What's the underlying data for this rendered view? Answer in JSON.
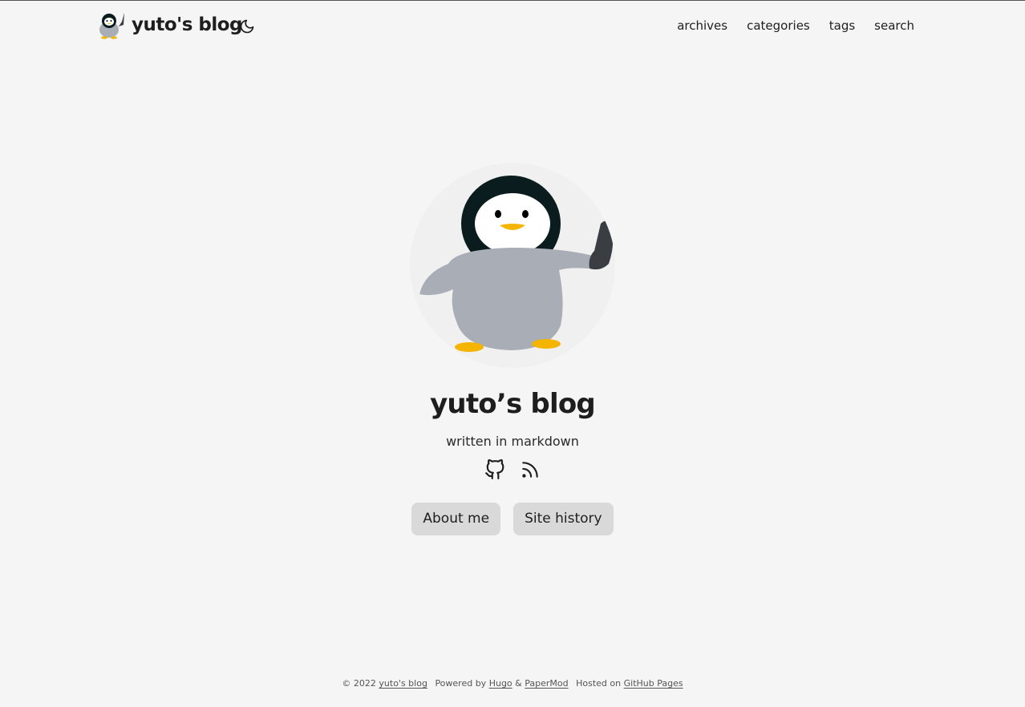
{
  "header": {
    "logo_text": "yuto's blog",
    "nav": [
      "archives",
      "categories",
      "tags",
      "search"
    ]
  },
  "profile": {
    "title": "yuto’s blog",
    "subtitle": "written in markdown",
    "social": [
      "github-icon",
      "rss-icon"
    ],
    "buttons": [
      "About me",
      "Site history"
    ]
  },
  "footer": {
    "copyright": "© 2022",
    "site_link": "yuto's blog",
    "powered_by": "Powered by",
    "hugo": "Hugo",
    "amp": "&",
    "papermod": "PaperMod",
    "hosted_on": "Hosted on",
    "github_pages": "GitHub Pages"
  },
  "colors": {
    "background": "#f5f5f5",
    "button": "#d9d9d9",
    "text": "#1e1e1e"
  }
}
